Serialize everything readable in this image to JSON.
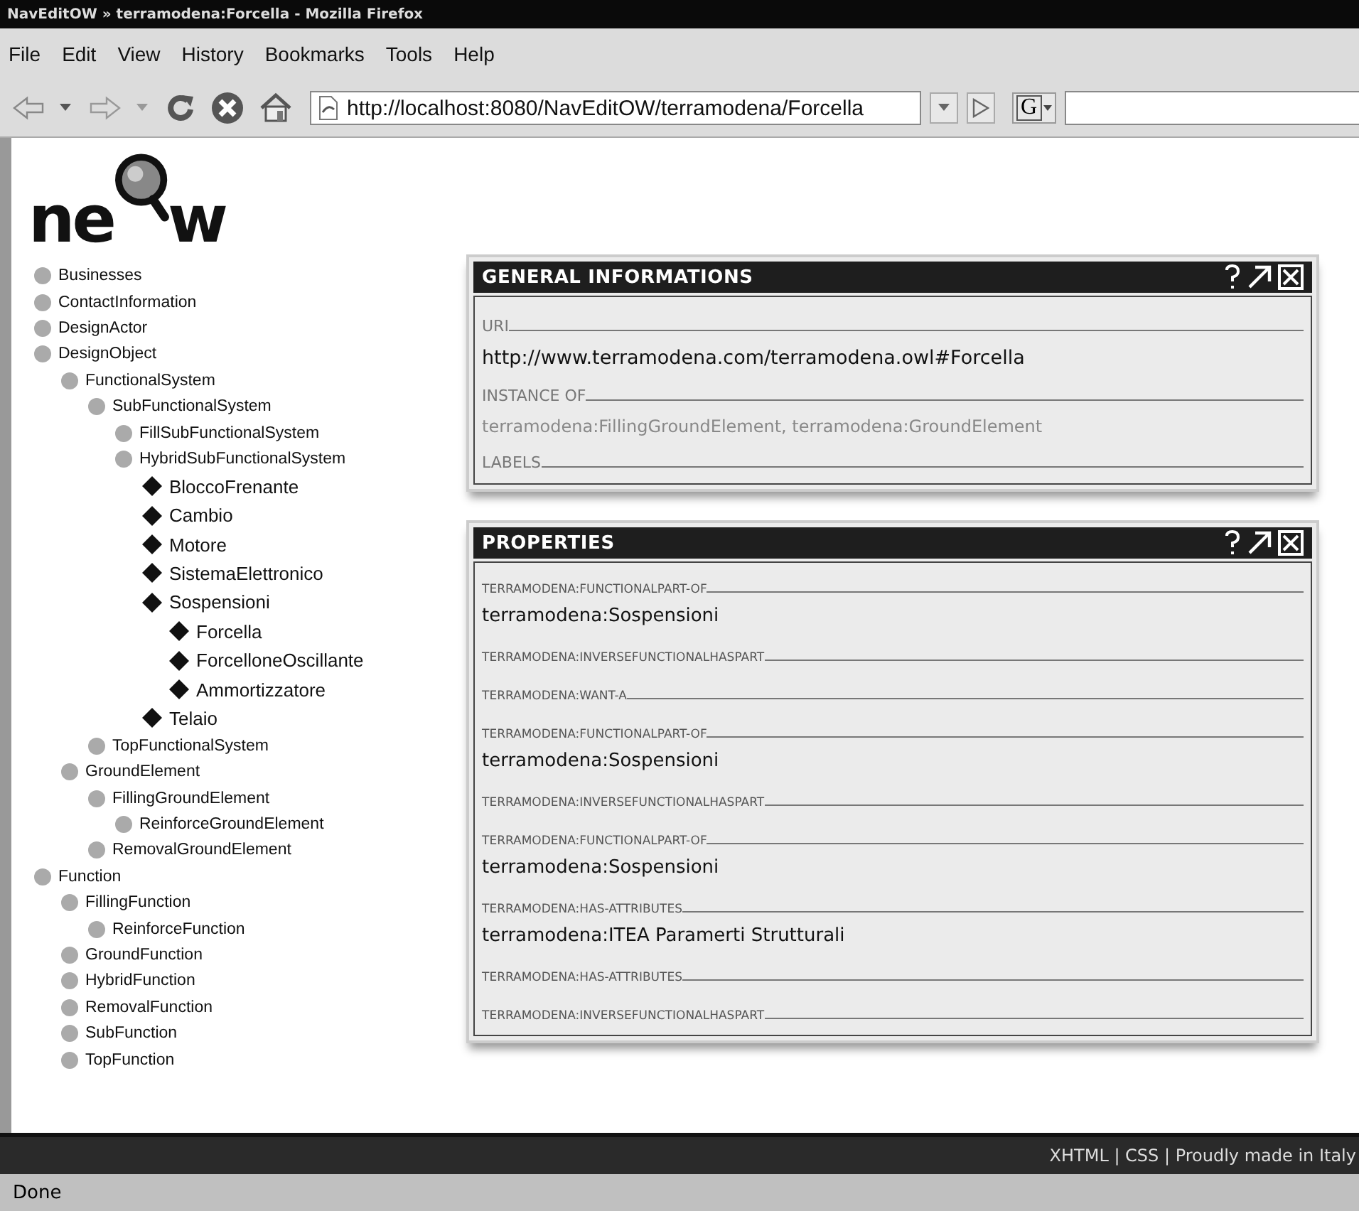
{
  "window": {
    "title": "NavEditOW » terramodena:Forcella - Mozilla Firefox"
  },
  "menu": [
    "File",
    "Edit",
    "View",
    "History",
    "Bookmarks",
    "Tools",
    "Help"
  ],
  "address_bar": {
    "value": "http://localhost:8080/NavEditOW/terramodena/Forcella"
  },
  "search_engine": {
    "label": "G"
  },
  "logo": {
    "before": "ne",
    "after": "w"
  },
  "tree": [
    {
      "label": "Businesses",
      "kind": "class"
    },
    {
      "label": "ContactInformation",
      "kind": "class"
    },
    {
      "label": "DesignActor",
      "kind": "class"
    },
    {
      "label": "DesignObject",
      "kind": "class",
      "children": [
        {
          "label": "FunctionalSystem",
          "kind": "class",
          "children": [
            {
              "label": "SubFunctionalSystem",
              "kind": "class",
              "children": [
                {
                  "label": "FillSubFunctionalSystem",
                  "kind": "class"
                },
                {
                  "label": "HybridSubFunctionalSystem",
                  "kind": "class",
                  "children": [
                    {
                      "label": "BloccoFrenante",
                      "kind": "instance"
                    },
                    {
                      "label": "Cambio",
                      "kind": "instance"
                    },
                    {
                      "label": "Motore",
                      "kind": "instance"
                    },
                    {
                      "label": "SistemaElettronico",
                      "kind": "instance"
                    },
                    {
                      "label": "Sospensioni",
                      "kind": "instance",
                      "children": [
                        {
                          "label": "Forcella",
                          "kind": "instance"
                        },
                        {
                          "label": "ForcelloneOscillante",
                          "kind": "instance"
                        },
                        {
                          "label": "Ammortizzatore",
                          "kind": "instance"
                        }
                      ]
                    },
                    {
                      "label": "Telaio",
                      "kind": "instance"
                    }
                  ]
                }
              ]
            },
            {
              "label": "TopFunctionalSystem",
              "kind": "class"
            }
          ]
        },
        {
          "label": "GroundElement",
          "kind": "class",
          "children": [
            {
              "label": "FillingGroundElement",
              "kind": "class",
              "children": [
                {
                  "label": "ReinforceGroundElement",
                  "kind": "class"
                }
              ]
            },
            {
              "label": "RemovalGroundElement",
              "kind": "class"
            }
          ]
        }
      ]
    },
    {
      "label": "Function",
      "kind": "class",
      "children": [
        {
          "label": "FillingFunction",
          "kind": "class",
          "children": [
            {
              "label": "ReinforceFunction",
              "kind": "class"
            }
          ]
        },
        {
          "label": "GroundFunction",
          "kind": "class"
        },
        {
          "label": "HybridFunction",
          "kind": "class"
        },
        {
          "label": "RemovalFunction",
          "kind": "class"
        },
        {
          "label": "SubFunction",
          "kind": "class"
        },
        {
          "label": "TopFunction",
          "kind": "class"
        }
      ]
    }
  ],
  "panels": [
    {
      "title": "GENERAL INFORMATIONS",
      "kind": "general",
      "sections": [
        {
          "label": "URI",
          "value": "http://www.terramodena.com/terramodena.owl#Forcella",
          "muted": false
        },
        {
          "label": "INSTANCE OF",
          "value": "terramodena:FillingGroundElement, terramodena:GroundElement",
          "muted": true
        },
        {
          "label": "LABELS"
        }
      ]
    },
    {
      "title": "PROPERTIES",
      "kind": "properties",
      "sections": [
        {
          "label": "TERRAMODENA:FUNCTIONALPART-OF",
          "value": "terramodena:Sospensioni",
          "muted": false
        },
        {
          "label": "TERRAMODENA:INVERSEFUNCTIONALHASPART"
        },
        {
          "label": "TERRAMODENA:WANT-A"
        },
        {
          "label": "TERRAMODENA:FUNCTIONALPART-OF",
          "value": "terramodena:Sospensioni",
          "muted": false
        },
        {
          "label": "TERRAMODENA:INVERSEFUNCTIONALHASPART"
        },
        {
          "label": "TERRAMODENA:FUNCTIONALPART-OF",
          "value": "terramodena:Sospensioni",
          "muted": false
        },
        {
          "label": "TERRAMODENA:HAS-ATTRIBUTES",
          "value": "terramodena:ITEA Paramerti Strutturali",
          "muted": false
        },
        {
          "label": "TERRAMODENA:HAS-ATTRIBUTES"
        },
        {
          "label": "TERRAMODENA:INVERSEFUNCTIONALHASPART"
        }
      ]
    }
  ],
  "footer": {
    "text": "XHTML | CSS | Proudly made in Italy"
  },
  "status_bar": {
    "text": "Done"
  }
}
